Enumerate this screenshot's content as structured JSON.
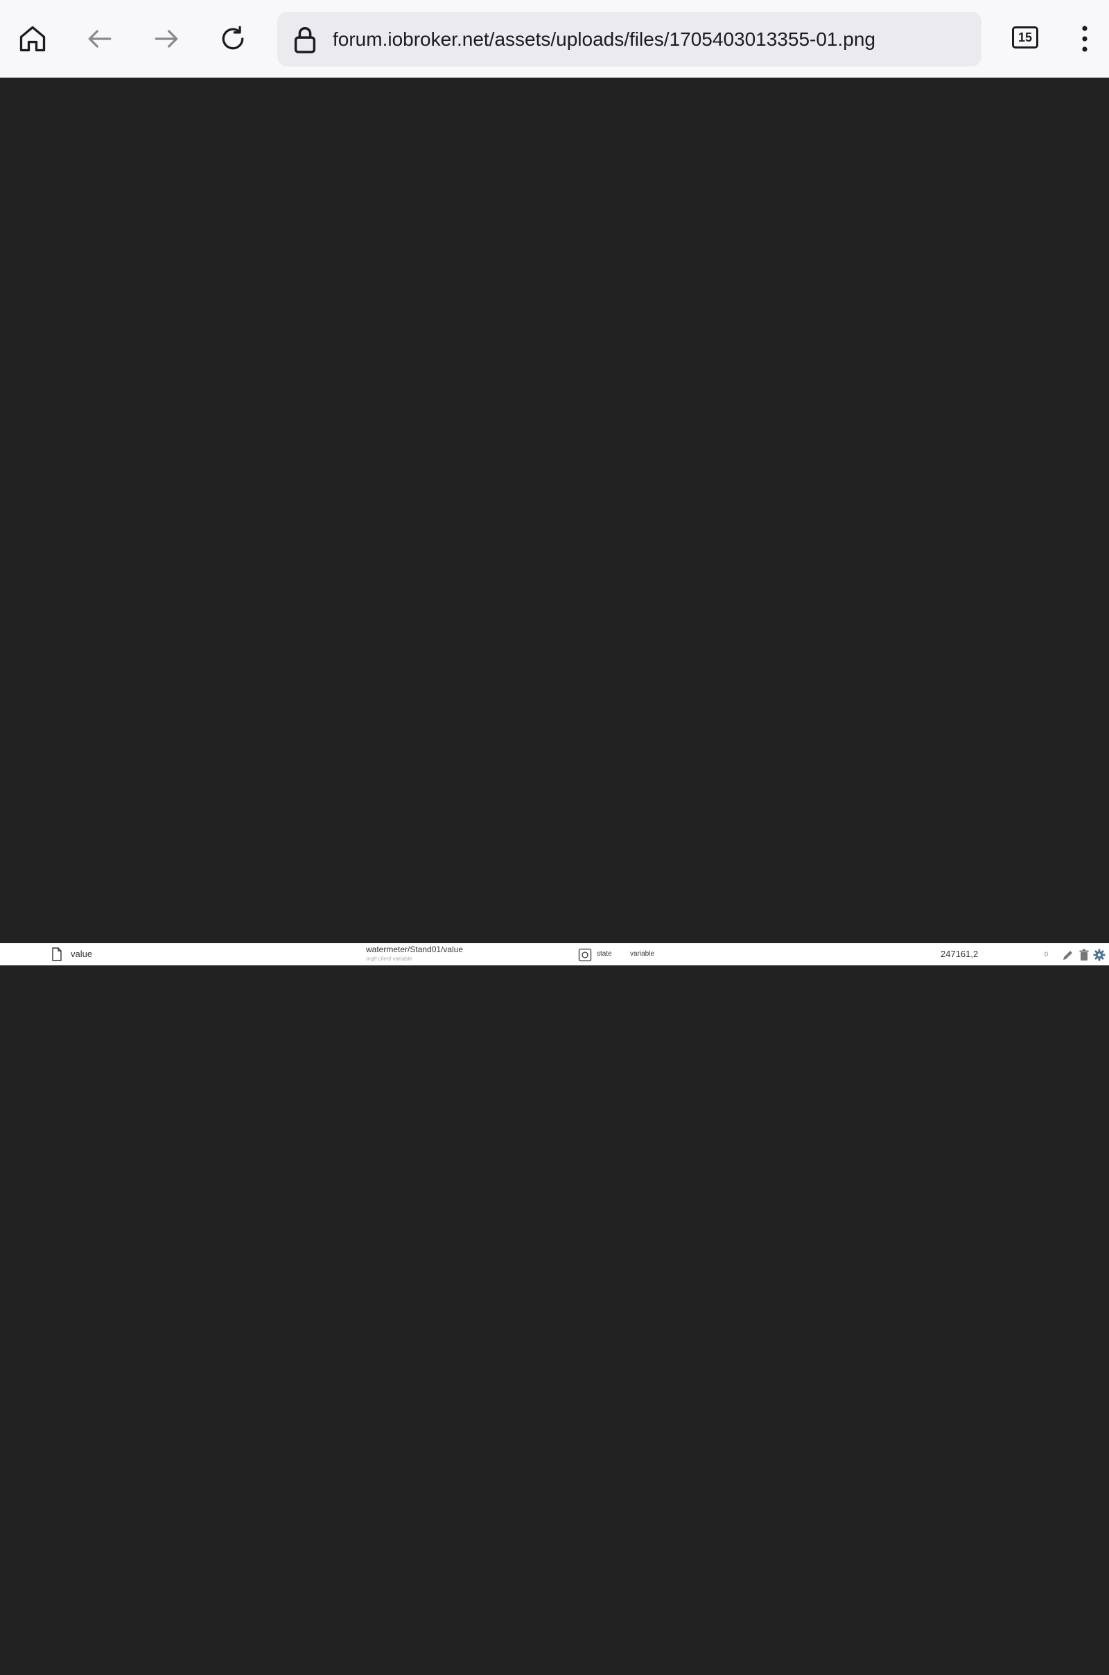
{
  "browser": {
    "url": "forum.iobroker.net/assets/uploads/files/1705403013355-01.png",
    "tab_count": "15",
    "icons": {
      "home": "home-icon",
      "back": "arrow-left-icon",
      "forward": "arrow-right-icon",
      "reload": "reload-icon",
      "lock": "lock-icon",
      "menu": "more-vertical-icon"
    }
  },
  "image_row": {
    "name": "value",
    "id": "watermeter/Stand01/value",
    "description": "mqtt client variable",
    "type": "state",
    "role": "variable",
    "value": "247161,2",
    "quality": "0",
    "icons": {
      "object": "file-icon",
      "type": "state-icon",
      "edit": "pencil-icon",
      "delete": "trash-icon",
      "settings": "gear-icon"
    }
  },
  "colors": {
    "toolbar_bg": "#f8f8fb",
    "url_bar_bg": "#ebebef",
    "viewer_bg": "#222222",
    "strip_bg": "#ffffff"
  }
}
